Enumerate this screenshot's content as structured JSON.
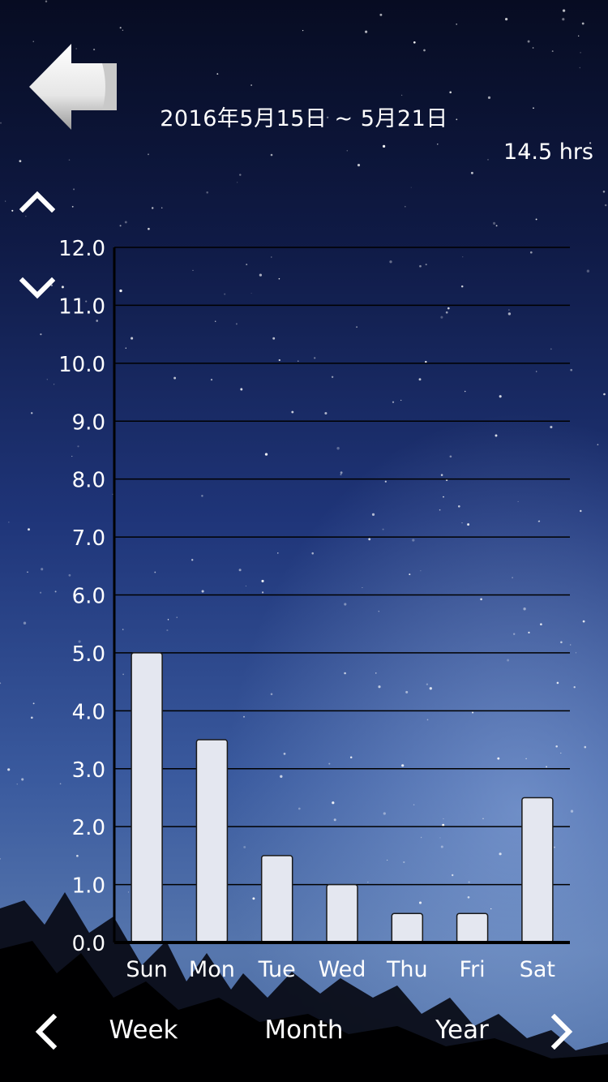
{
  "header": {
    "back_icon": "back-arrow-icon",
    "date_range": "2016年5月15日 ~ 5月21日",
    "total": "14.5 hrs"
  },
  "scale_controls": {
    "up_icon": "chevron-up-icon",
    "down_icon": "chevron-down-icon"
  },
  "chart_data": {
    "type": "bar",
    "categories": [
      "Sun",
      "Mon",
      "Tue",
      "Wed",
      "Thu",
      "Fri",
      "Sat"
    ],
    "values": [
      5.0,
      3.5,
      1.5,
      1.0,
      0.5,
      0.5,
      2.5
    ],
    "ylim": [
      0,
      12
    ],
    "yticks": [
      "0.0",
      "1.0",
      "2.0",
      "3.0",
      "4.0",
      "5.0",
      "6.0",
      "7.0",
      "8.0",
      "9.0",
      "10.0",
      "11.0",
      "12.0"
    ],
    "grid": true,
    "bar_color": "#e4e7f0",
    "grid_color": "#000000"
  },
  "footer": {
    "prev_icon": "chevron-left-icon",
    "next_icon": "chevron-right-icon",
    "tabs": [
      "Week",
      "Month",
      "Year"
    ]
  }
}
